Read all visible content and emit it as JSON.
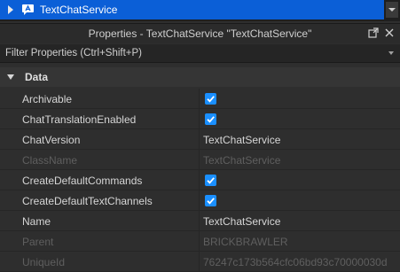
{
  "explorer": {
    "selected_label": "TextChatService",
    "icon": "text-chat-service-icon"
  },
  "properties_window": {
    "title": "Properties - TextChatService \"TextChatService\"",
    "float_icon": "undock-icon",
    "close_icon": "close-icon",
    "filter_placeholder": "Filter Properties (Ctrl+Shift+P)"
  },
  "category": {
    "label": "Data",
    "expanded": true
  },
  "properties": [
    {
      "name": "Archivable",
      "type": "bool",
      "checked": true,
      "disabled": false
    },
    {
      "name": "ChatTranslationEnabled",
      "type": "bool",
      "checked": true,
      "disabled": false
    },
    {
      "name": "ChatVersion",
      "type": "text",
      "value": "TextChatService",
      "disabled": false
    },
    {
      "name": "ClassName",
      "type": "text",
      "value": "TextChatService",
      "disabled": true
    },
    {
      "name": "CreateDefaultCommands",
      "type": "bool",
      "checked": true,
      "disabled": false
    },
    {
      "name": "CreateDefaultTextChannels",
      "type": "bool",
      "checked": true,
      "disabled": false
    },
    {
      "name": "Name",
      "type": "text",
      "value": "TextChatService",
      "disabled": false
    },
    {
      "name": "Parent",
      "type": "text",
      "value": "BRICKBRAWLER",
      "disabled": true
    },
    {
      "name": "UniqueId",
      "type": "text",
      "value": "76247c173b564cfc06bd93c70000030d",
      "disabled": true
    }
  ],
  "colors": {
    "selection": "#0b5fd7",
    "checkbox": "#1a8fff",
    "background": "#2e2e2e"
  }
}
